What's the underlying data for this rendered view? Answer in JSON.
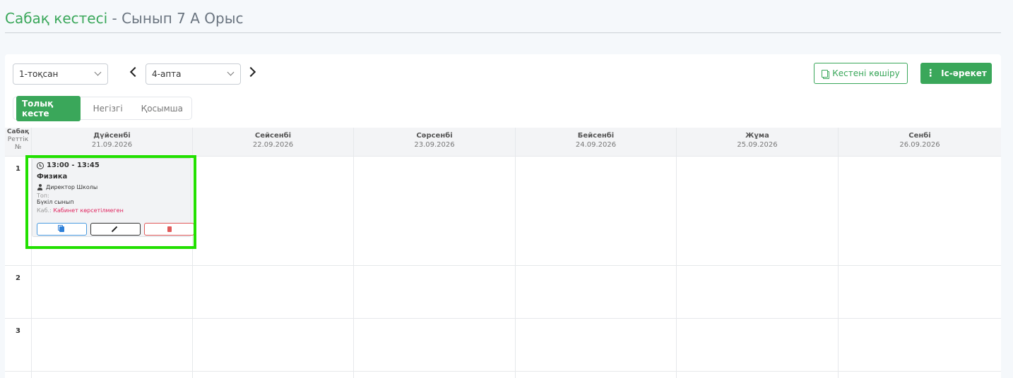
{
  "header": {
    "title_main": "Сабақ кестесі",
    "title_sep": " - ",
    "title_sub": "Сынып 7 А Орыс"
  },
  "toolbar": {
    "quarter": "1-тоқсан",
    "week": "4-апта",
    "copy_label": "Кестені көшіру",
    "action_label": "Іс-әрекет"
  },
  "tabs": [
    {
      "label": "Толық кесте",
      "active": true
    },
    {
      "label": "Негізгі",
      "active": false
    },
    {
      "label": "Қосымша",
      "active": false
    }
  ],
  "grid": {
    "num_head": {
      "l1": "Сабақ",
      "l2": "Реттік",
      "l3": "№"
    },
    "days": [
      {
        "name": "Дүйсенбі",
        "date": "21.09.2026"
      },
      {
        "name": "Сейсенбі",
        "date": "22.09.2026"
      },
      {
        "name": "Сәрсенбі",
        "date": "23.09.2026"
      },
      {
        "name": "Бейсенбі",
        "date": "24.09.2026"
      },
      {
        "name": "Жұма",
        "date": "25.09.2026"
      },
      {
        "name": "Сенбі",
        "date": "26.09.2026"
      }
    ],
    "rows": [
      "1",
      "2",
      "3"
    ]
  },
  "lesson": {
    "time": "13:00 - 13:45",
    "subject": "Физика",
    "teacher": "Директор Школы",
    "group_label": "Топ:",
    "group_value": "Бүкіл сынып",
    "room_label": "Каб.:",
    "room_value": "Кабинет көрсетілмеген"
  },
  "colors": {
    "accent": "#3aa75a",
    "highlight": "#22e000",
    "danger": "#e0245e"
  }
}
